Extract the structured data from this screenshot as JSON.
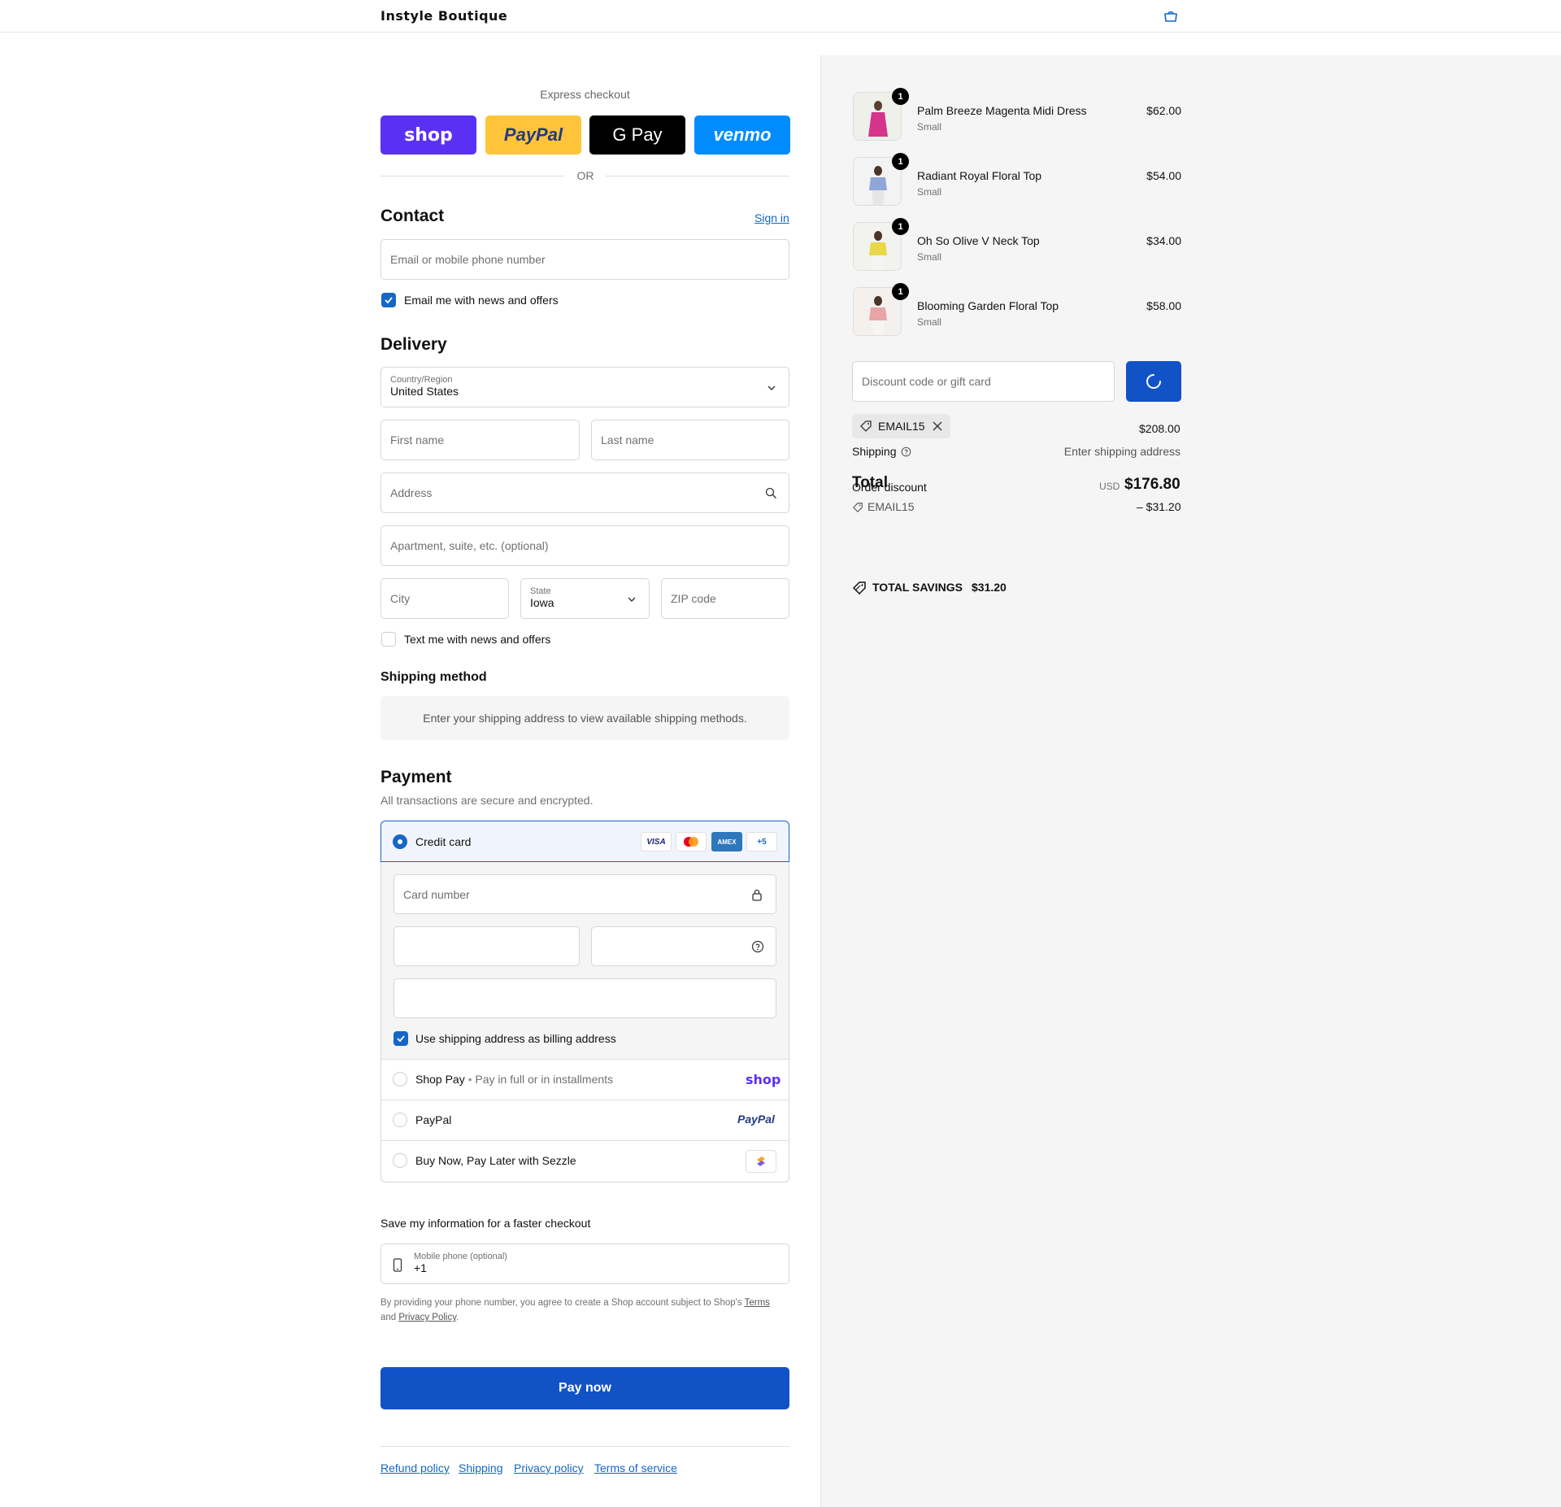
{
  "header": {
    "brand": "Instyle Boutique"
  },
  "express": {
    "label": "Express checkout",
    "buttons": [
      {
        "label": "shop",
        "color": "#5a31f4"
      },
      {
        "label": "PayPal",
        "color": "#ffc439"
      },
      {
        "label": "G Pay",
        "color": "#000000"
      },
      {
        "label": "venmo",
        "color": "#008cff"
      }
    ],
    "or": "OR"
  },
  "contact": {
    "heading": "Contact",
    "sign_in": "Sign in",
    "email_placeholder": "Email or mobile phone number",
    "newsletter_label": "Email me with news and offers",
    "newsletter_checked": true
  },
  "delivery": {
    "heading": "Delivery",
    "country_label": "Country/Region",
    "country_value": "United States",
    "first_name": "First name",
    "last_name": "Last name",
    "address": "Address",
    "apartment": "Apartment, suite, etc. (optional)",
    "city": "City",
    "state_label": "State",
    "state_value": "Iowa",
    "zip": "ZIP code",
    "sms_label": "Text me with news and offers",
    "sms_checked": false
  },
  "shipping_method": {
    "heading": "Shipping method",
    "notice": "Enter your shipping address to view available shipping methods."
  },
  "payment": {
    "heading": "Payment",
    "subtitle": "All transactions are secure and encrypted.",
    "credit_card": "Credit card",
    "card_logos": [
      "VISA",
      "Mastercard",
      "AMEX",
      "+5"
    ],
    "card_number": "Card number",
    "billing_label": "Use shipping address as billing address",
    "billing_checked": true,
    "options": [
      {
        "label": "Shop Pay",
        "sub": "Pay in full or in installments",
        "badge": "shop"
      },
      {
        "label": "PayPal",
        "sub": "",
        "badge": "PayPal"
      },
      {
        "label": "Buy Now, Pay Later with Sezzle",
        "sub": "",
        "badge": "sezzle-icon"
      }
    ]
  },
  "save_info": {
    "heading": "Save my information for a faster checkout",
    "phone_label": "Mobile phone (optional)",
    "phone_value": "+1",
    "legal_pre": "By providing your phone number, you agree to create a Shop account subject to Shop's",
    "terms": "Terms",
    "and": "and",
    "privacy": "Privacy Policy",
    "period": "."
  },
  "pay_now": "Pay now",
  "footer_links": [
    "Refund policy",
    "Shipping",
    "Privacy policy",
    "Terms of service"
  ],
  "summary": {
    "items": [
      {
        "title": "Palm Breeze Magenta Midi Dress",
        "variant": "Small",
        "price": "$62.00",
        "qty": "1",
        "color": "#d6338a"
      },
      {
        "title": "Radiant Royal Floral Top",
        "variant": "Small",
        "price": "$54.00",
        "qty": "1",
        "color": "#8fa7d6"
      },
      {
        "title": "Oh So Olive V Neck Top",
        "variant": "Small",
        "price": "$34.00",
        "qty": "1",
        "color": "#e8d84a"
      },
      {
        "title": "Blooming Garden Floral Top",
        "variant": "Small",
        "price": "$58.00",
        "qty": "1",
        "color": "#e7a5a5"
      }
    ],
    "discount_placeholder": "Discount code or gift card",
    "applied_code": "EMAIL15",
    "subtotal": "$208.00",
    "shipping_label": "Shipping",
    "shipping_value": "Enter shipping address",
    "order_discount_label": "Order discount",
    "order_discount_code": "EMAIL15",
    "order_discount_value": "– $31.20",
    "total_label": "Total",
    "currency": "USD",
    "total": "$176.80",
    "savings_label": "TOTAL SAVINGS",
    "savings_value": "$31.20"
  },
  "colors": {
    "accent": "#1666c6",
    "panel": "#f5f5f5"
  }
}
